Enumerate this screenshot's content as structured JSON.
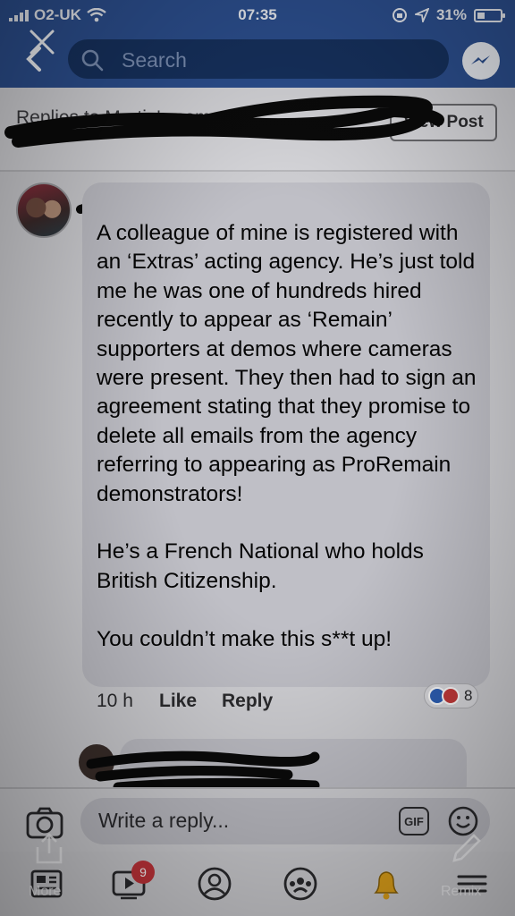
{
  "status_bar": {
    "carrier": "O2-UK",
    "time": "07:35",
    "battery": "31%"
  },
  "header": {
    "search_placeholder": "Search"
  },
  "subheader": {
    "title": "Replies to Martin's comment",
    "view_post_label": "View Post"
  },
  "comment": {
    "paragraphs": [
      "A colleague of mine is registered with an ‘Extras’ acting agency. He’s just told me he was one of hundreds hired recently to appear as ‘Remain’ supporters at demos where cameras were present. They then had to sign an agreement stating that they promise to delete all emails from the agency referring to appearing as ProRemain demonstrators!",
      "He’s a French National who holds British Citizenship.",
      "You couldn’t make this s**t up!"
    ],
    "timestamp": "10 h",
    "like_label": "Like",
    "reply_label": "Reply",
    "reaction_count": "8"
  },
  "composer": {
    "placeholder": "Write a reply...",
    "gif_label": "GIF"
  },
  "tabbar": {
    "notifications_badge": "9",
    "overlay_left_label": "More",
    "overlay_right_label": "Remix"
  },
  "colors": {
    "header_blue": "#2c4f8f",
    "search_fill": "#16315e",
    "bubble_gray": "#bfbfc6",
    "like_blue": "#2d5fb5",
    "love_red": "#c43a3a"
  }
}
